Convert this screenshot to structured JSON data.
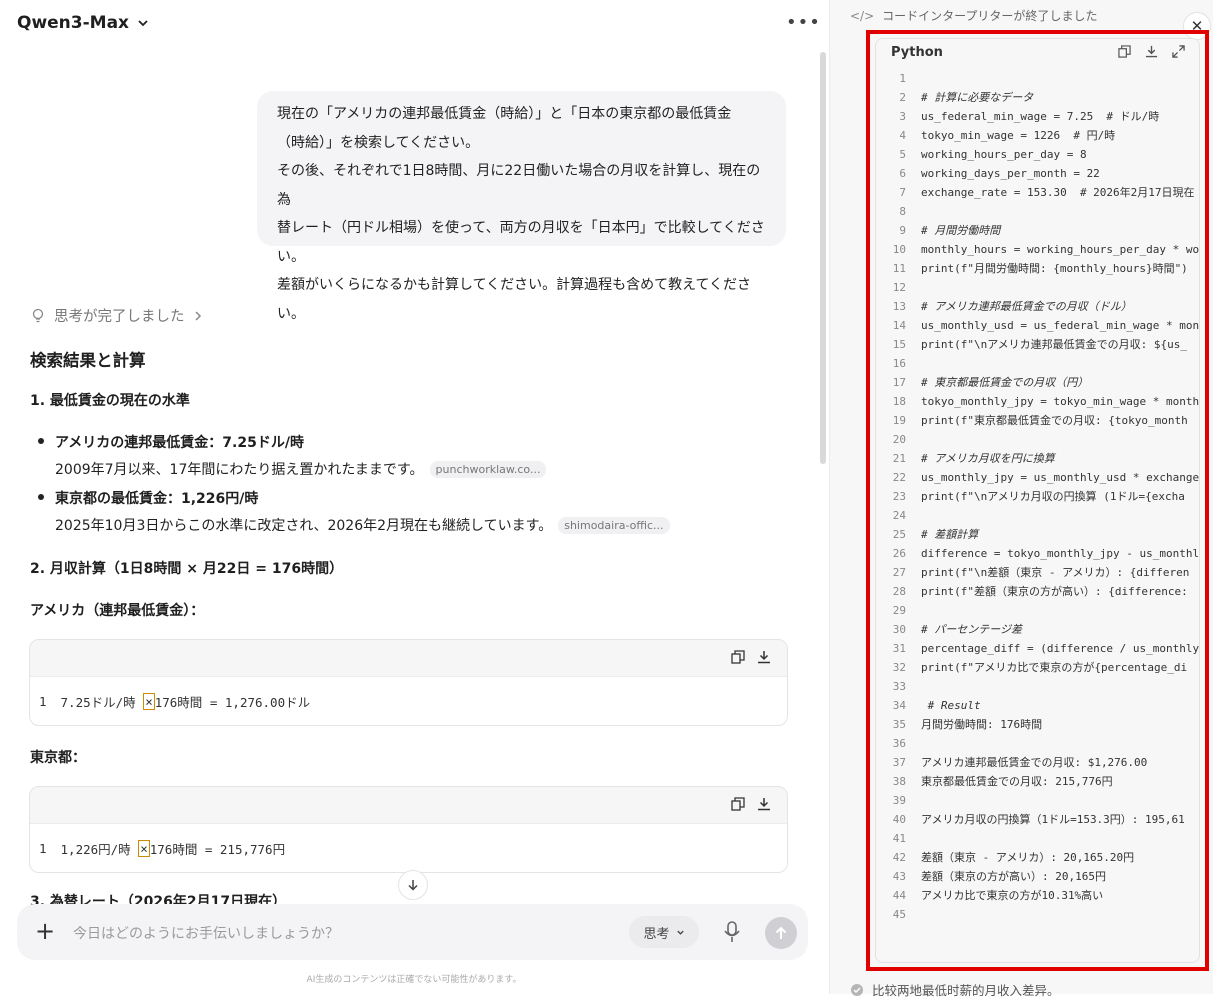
{
  "header": {
    "model": "Qwen3-Max"
  },
  "user_message": {
    "lines": [
      "現在の「アメリカの連邦最低賃金（時給）」と「日本の東京都の最低賃金",
      "（時給）」を検索してください。",
      "その後、それぞれで1日8時間、月に22日働いた場合の月収を計算し、現在の為",
      "替レート（円ドル相場）を使って、両方の月収を「日本円」で比較してください。",
      "差額がいくらになるかも計算してください。計算過程も含めて教えてください。"
    ]
  },
  "thinking": {
    "label": "思考が完了しました"
  },
  "answer": {
    "title": "検索結果と計算",
    "section1": "1. 最低賃金の現在の水準",
    "items": [
      {
        "head": "アメリカの連邦最低賃金：7.25ドル/時",
        "detail": "2009年7月以来、17年間にわたり据え置かれたままです。",
        "source": "punchworklaw.co..."
      },
      {
        "head": "東京都の最低賃金：1,226円/時",
        "detail": "2025年10月3日からこの水準に改定され、2026年2月現在も継続しています。",
        "source": "shimodaira-offic..."
      }
    ],
    "section2": "2. 月収計算（1日8時間 × 月22日 = 176時間）",
    "us_label": "アメリカ（連邦最低賃金）：",
    "us_code": {
      "ln": "1",
      "pre": "7.25ドル/時 ",
      "op": "×",
      "post": " 176時間 = 1,276.00ドル"
    },
    "tokyo_label": "東京都：",
    "tokyo_code": {
      "ln": "1",
      "pre": "1,226円/時 ",
      "op": "×",
      "post": " 176時間 = 215,776円"
    },
    "section3": "3. 為替レート（2026年2月17日現在）"
  },
  "input": {
    "placeholder": "今日はどのようにお手伝いしましょうか？",
    "think_btn": "思考"
  },
  "disclaimer": "AI生成のコンテンツは正確でない可能性があります。",
  "right_panel": {
    "status": "コードインタープリターが終了しました",
    "language": "Python",
    "footer": "比较两地最低时薪的月收入差异。",
    "code": [
      {
        "n": "1",
        "t": ""
      },
      {
        "n": "2",
        "t": "# 計算に必要なデータ",
        "c": "cm"
      },
      {
        "n": "3",
        "t": "us_federal_min_wage = 7.25  # ドル/時"
      },
      {
        "n": "4",
        "t": "tokyo_min_wage = 1226  # 円/時"
      },
      {
        "n": "5",
        "t": "working_hours_per_day = 8"
      },
      {
        "n": "6",
        "t": "working_days_per_month = 22"
      },
      {
        "n": "7",
        "t": "exchange_rate = 153.30  # 2026年2月17日現在"
      },
      {
        "n": "8",
        "t": ""
      },
      {
        "n": "9",
        "t": "# 月間労働時間",
        "c": "cm"
      },
      {
        "n": "10",
        "t": "monthly_hours = working_hours_per_day * wor"
      },
      {
        "n": "11",
        "t": "print(f\"月間労働時間: {monthly_hours}時間\")",
        "c": "kw"
      },
      {
        "n": "12",
        "t": ""
      },
      {
        "n": "13",
        "t": "# アメリカ連邦最低賃金での月収（ドル）",
        "c": "cm"
      },
      {
        "n": "14",
        "t": "us_monthly_usd = us_federal_min_wage * mont"
      },
      {
        "n": "15",
        "t": "print(f\"\\nアメリカ連邦最低賃金での月収: ${us_",
        "c": "kw"
      },
      {
        "n": "16",
        "t": ""
      },
      {
        "n": "17",
        "t": "# 東京都最低賃金での月収（円）",
        "c": "cm"
      },
      {
        "n": "18",
        "t": "tokyo_monthly_jpy = tokyo_min_wage * monthl"
      },
      {
        "n": "19",
        "t": "print(f\"東京都最低賃金での月収: {tokyo_month",
        "c": "kw"
      },
      {
        "n": "20",
        "t": ""
      },
      {
        "n": "21",
        "t": "# アメリカ月収を円に換算",
        "c": "cm"
      },
      {
        "n": "22",
        "t": "us_monthly_jpy = us_monthly_usd * exchange_"
      },
      {
        "n": "23",
        "t": "print(f\"\\nアメリカ月収の円換算 (1ドル={excha",
        "c": "kw"
      },
      {
        "n": "24",
        "t": ""
      },
      {
        "n": "25",
        "t": "# 差額計算",
        "c": "cm"
      },
      {
        "n": "26",
        "t": "difference = tokyo_monthly_jpy - us_monthly"
      },
      {
        "n": "27",
        "t": "print(f\"\\n差額（東京 - アメリカ）: {differen",
        "c": "kw"
      },
      {
        "n": "28",
        "t": "print(f\"差額（東京の方が高い）: {difference:",
        "c": "kw"
      },
      {
        "n": "29",
        "t": ""
      },
      {
        "n": "30",
        "t": "# パーセンテージ差",
        "c": "cm"
      },
      {
        "n": "31",
        "t": "percentage_diff = (difference / us_monthly_"
      },
      {
        "n": "32",
        "t": "print(f\"アメリカ比で東京の方が{percentage_di",
        "c": "kw"
      },
      {
        "n": "33",
        "t": ""
      },
      {
        "n": "34",
        "t": " # Result",
        "c": "cm"
      },
      {
        "n": "35",
        "t": "月間労働時間: 176時間"
      },
      {
        "n": "36",
        "t": ""
      },
      {
        "n": "37",
        "t": "アメリカ連邦最低賃金での月収: $1,276.00"
      },
      {
        "n": "38",
        "t": "東京都最低賃金での月収: 215,776円"
      },
      {
        "n": "39",
        "t": ""
      },
      {
        "n": "40",
        "t": "アメリカ月収の円換算（1ドル=153.3円）: 195,61"
      },
      {
        "n": "41",
        "t": ""
      },
      {
        "n": "42",
        "t": "差額（東京 - アメリカ）: 20,165.20円"
      },
      {
        "n": "43",
        "t": "差額（東京の方が高い）: 20,165円"
      },
      {
        "n": "44",
        "t": "アメリカ比で東京の方が10.31%高い"
      },
      {
        "n": "45",
        "t": ""
      }
    ]
  }
}
